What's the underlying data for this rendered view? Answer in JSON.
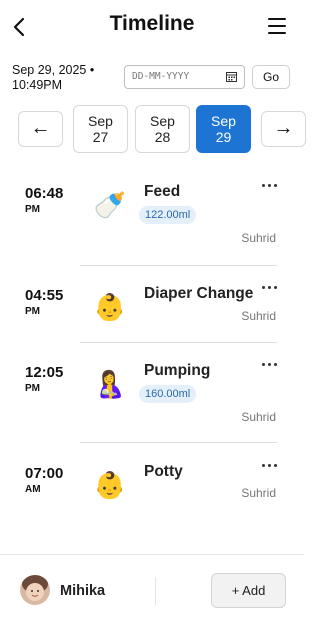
{
  "header": {
    "title": "Timeline"
  },
  "date_bar": {
    "current_datetime": "Sep 29, 2025 • 10:49PM",
    "date_placeholder": "DD-MM-YYYY",
    "go_label": "Go"
  },
  "day_nav": {
    "prev_label": "←",
    "next_label": "→",
    "days": [
      {
        "month": "Sep",
        "day": "27"
      },
      {
        "month": "Sep",
        "day": "28"
      },
      {
        "month": "Sep",
        "day": "29"
      }
    ]
  },
  "entries": [
    {
      "time": "06:48",
      "ampm": "PM",
      "icon": "baby-bottle-icon",
      "emoji": "🍼",
      "title": "Feed",
      "amount": "122.00ml",
      "author": "Suhrid"
    },
    {
      "time": "04:55",
      "ampm": "PM",
      "icon": "baby-face-icon",
      "emoji": "👶",
      "title": "Diaper Change",
      "amount": "",
      "author": "Suhrid"
    },
    {
      "time": "12:05",
      "ampm": "PM",
      "icon": "breastfeeding-icon",
      "emoji": "🤱",
      "title": "Pumping",
      "amount": "160.00ml",
      "author": "Suhrid"
    },
    {
      "time": "07:00",
      "ampm": "AM",
      "icon": "baby-face-icon",
      "emoji": "👶",
      "title": "Potty",
      "amount": "",
      "author": "Suhrid"
    }
  ],
  "footer": {
    "child_name": "Mihika",
    "add_label": "+ Add"
  }
}
